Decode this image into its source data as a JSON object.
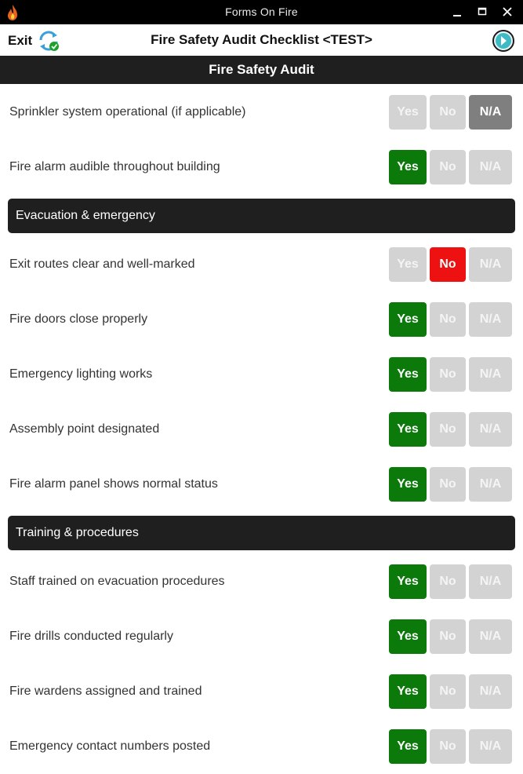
{
  "window": {
    "title": "Forms On Fire",
    "app_icon": "flame-icon",
    "controls": [
      "minimize-icon",
      "maximize-icon",
      "close-icon"
    ]
  },
  "header": {
    "exit_label": "Exit",
    "sync_icon": "sync-check-icon",
    "form_title": "Fire Safety Audit Checklist <TEST>",
    "next_icon": "arrow-right-circle-icon"
  },
  "section_title": "Fire Safety Audit",
  "options": {
    "yes": "Yes",
    "no": "No",
    "na": "N/A"
  },
  "colors": {
    "yes_selected": "#0b7a0b",
    "no_selected": "#ee1111",
    "na_selected": "#7f7f7f",
    "unselected": "#d3d3d3",
    "header_bar": "#1f1f1f"
  },
  "questions_top": [
    {
      "label": "Sprinkler system operational (if applicable)",
      "selected": "na"
    },
    {
      "label": "Fire alarm audible throughout building",
      "selected": "yes"
    }
  ],
  "group_evacuation": {
    "title": "Evacuation & emergency",
    "questions": [
      {
        "label": "Exit routes clear and well-marked",
        "selected": "no"
      },
      {
        "label": "Fire doors close properly",
        "selected": "yes"
      },
      {
        "label": "Emergency lighting works",
        "selected": "yes"
      },
      {
        "label": "Assembly point designated",
        "selected": "yes"
      },
      {
        "label": "Fire alarm panel shows normal status",
        "selected": "yes"
      }
    ]
  },
  "group_training": {
    "title": "Training & procedures",
    "questions": [
      {
        "label": "Staff trained on evacuation procedures",
        "selected": "yes"
      },
      {
        "label": "Fire drills conducted regularly",
        "selected": "yes"
      },
      {
        "label": "Fire wardens assigned and trained",
        "selected": "yes"
      },
      {
        "label": "Emergency contact numbers posted",
        "selected": "yes"
      }
    ]
  }
}
